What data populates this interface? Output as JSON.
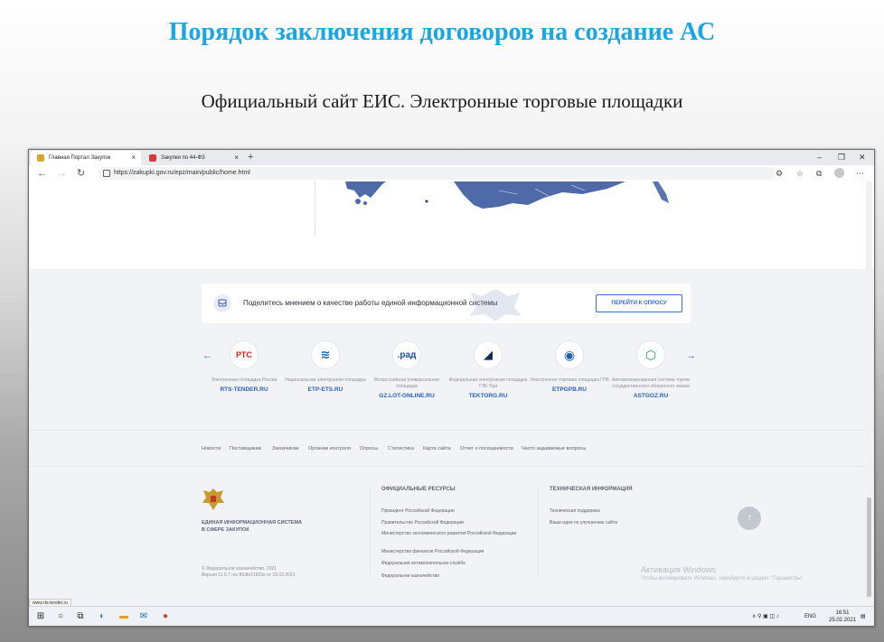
{
  "slide": {
    "title": "Порядок заключения договоров на создание АС",
    "subtitle": "Официальный сайт ЕИС. Электронные торговые площадки"
  },
  "browser": {
    "tabs": [
      {
        "label": "Главная Портал Закупок",
        "active": true
      },
      {
        "label": "Закупки по 44-ФЗ",
        "active": false
      }
    ],
    "url": "https://zakupki.gov.ru/epz/main/public/home.html",
    "status_url": "www.rts-tender.ru"
  },
  "feedback": {
    "text": "Поделитесь мнением о качестве работы единой информационной системы",
    "button": "ПЕРЕЙТИ К ОПРОСУ"
  },
  "platforms": [
    {
      "logo": "РТС",
      "desc": "Электронная площадка России",
      "name": "RTS-TENDER.RU",
      "color": "#e2231a"
    },
    {
      "logo": "≋",
      "desc": "Национальная электронная площадка",
      "name": "ETP-ETS.RU",
      "color": "#1a62b4"
    },
    {
      "logo": ".рад",
      "desc": "Всероссийская универсальная площадка",
      "name": "GZ.LOT-ONLINE.RU",
      "color": "#1a4fa0"
    },
    {
      "logo": "◢",
      "desc": "Федеральная электронная площадка ТЭК-Торг",
      "name": "TEKTORG.RU",
      "color": "#0f2b5b"
    },
    {
      "logo": "◉",
      "desc": "Электронная торговая площадка ГПБ",
      "name": "ETPGPB.RU",
      "color": "#1e5fb0"
    },
    {
      "logo": "⬡",
      "desc": "Автоматизированная система торгов государственного оборонного заказа",
      "name": "ASTGOZ.RU",
      "color": "#1f9a6a"
    }
  ],
  "footer_links": [
    "Новости",
    "Поставщикам",
    "Заказчикам",
    "Органам контроля",
    "Опросы",
    "Статистика",
    "Карта сайта",
    "Отчет о посещаемости",
    "Часто задаваемые вопросы"
  ],
  "footer": {
    "system_name_1": "ЕДИНАЯ ИНФОРМАЦИОННАЯ СИСТЕМА",
    "system_name_2": "В СФЕРЕ ЗАКУПОК",
    "copyright": "© Федеральное казначейство, 2021",
    "version": "Версия 11.0.7 rev 86dfe21933e от 19.02.2021",
    "resources_title": "ОФИЦИАЛЬНЫЕ РЕСУРСЫ",
    "resources": [
      "Президент Российской Федерации",
      "Правительство Российской Федерации",
      "Министерство экономического развития Российской Федерации",
      "Министерство финансов Российской Федерации",
      "Федеральная антимонопольная служба",
      "Федеральное казначейство"
    ],
    "tech_title": "ТЕХНИЧЕСКАЯ ИНФОРМАЦИЯ",
    "tech": [
      "Техническая поддержка",
      "Ваши идеи по улучшению сайта"
    ]
  },
  "activation": {
    "title": "Активация Windows",
    "text": "Чтобы активировать Windows, перейдите в раздел \"Параметры\"."
  },
  "taskbar": {
    "lang": "ENG",
    "time": "16:51",
    "date": "25.02.2021"
  }
}
